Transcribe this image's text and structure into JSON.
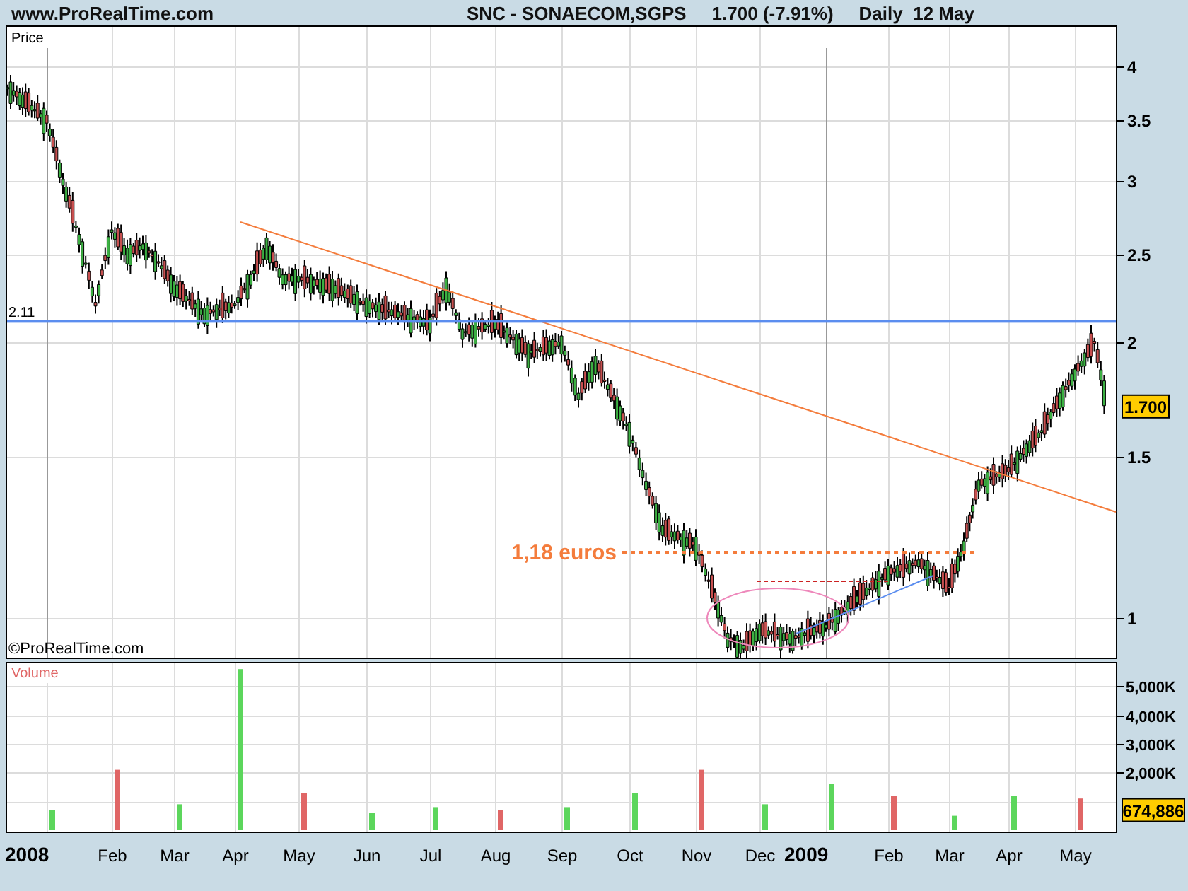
{
  "header": {
    "site": "www.ProRealTime.com",
    "symbol": "SNC - SONAECOM,SGPS",
    "quote": "1.700 (-7.91%)",
    "period": "Daily  12 May"
  },
  "price_panel": {
    "label": "Price",
    "copyright": "©ProRealTime.com",
    "last_price_tag": "1.700",
    "axis_labels": [
      "4",
      "3.5",
      "3",
      "2.5",
      "2",
      "1.5",
      "1"
    ],
    "level_lines": [
      {
        "label": "2.11",
        "kind": "solid",
        "color": "#5b8def"
      },
      {
        "label": "1,18 euros",
        "kind": "dotted",
        "color": "#f47c3c"
      }
    ]
  },
  "volume_panel": {
    "last_volume_tag": "674,886",
    "chart_data": {
      "type": "bar",
      "grid": true,
      "categories": [
        "2008",
        "Feb",
        "Mar",
        "Apr",
        "May",
        "Jun",
        "Jul",
        "Aug",
        "Sep",
        "Oct",
        "Nov",
        "Dec",
        "2009",
        "Feb",
        "Mar",
        "Apr",
        "May"
      ],
      "series": [
        {
          "name": "Volume",
          "values": [
            700,
            2100,
            900,
            5600,
            1300,
            600,
            800,
            700,
            800,
            1300,
            2100,
            900,
            1600,
            1200,
            500,
            1200,
            1100
          ]
        }
      ],
      "ylim": [
        0,
        5800
      ],
      "yticks": [
        {
          "value": 2000,
          "label": "2,000K"
        },
        {
          "value": 3000,
          "label": "3,000K"
        },
        {
          "value": 4000,
          "label": "4,000K"
        },
        {
          "value": 5000,
          "label": "5,000K"
        }
      ]
    }
  }
}
